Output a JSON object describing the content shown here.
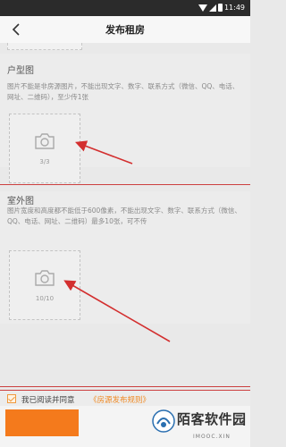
{
  "status_bar": {
    "time": "11:49"
  },
  "header": {
    "title": "发布租房"
  },
  "floor_plan": {
    "title": "户型图",
    "desc": "图片不能是非房源图片，不能出现文字、数字、联系方式（微信、QQ、电话、网址、二维码），至少传1张",
    "count": "3/3"
  },
  "exterior": {
    "title": "室外图",
    "desc": "图片宽度和高度都不能低于600像素，不能出现文字、数字、联系方式（微信、QQ、电话、网址、二维码）最多10张，可不传",
    "count": "10/10"
  },
  "agreement": {
    "text": "我已阅读并同意",
    "link": "《房源发布规则》"
  },
  "watermark": {
    "brand": "陌客软件园",
    "site": "IMOOC.XIN"
  },
  "colors": {
    "accent": "#f47a1c",
    "annotation": "#d32f2f"
  },
  "icons": {
    "back": "back-arrow-icon",
    "camera": "camera-icon",
    "check": "checkbox-checked-icon"
  }
}
